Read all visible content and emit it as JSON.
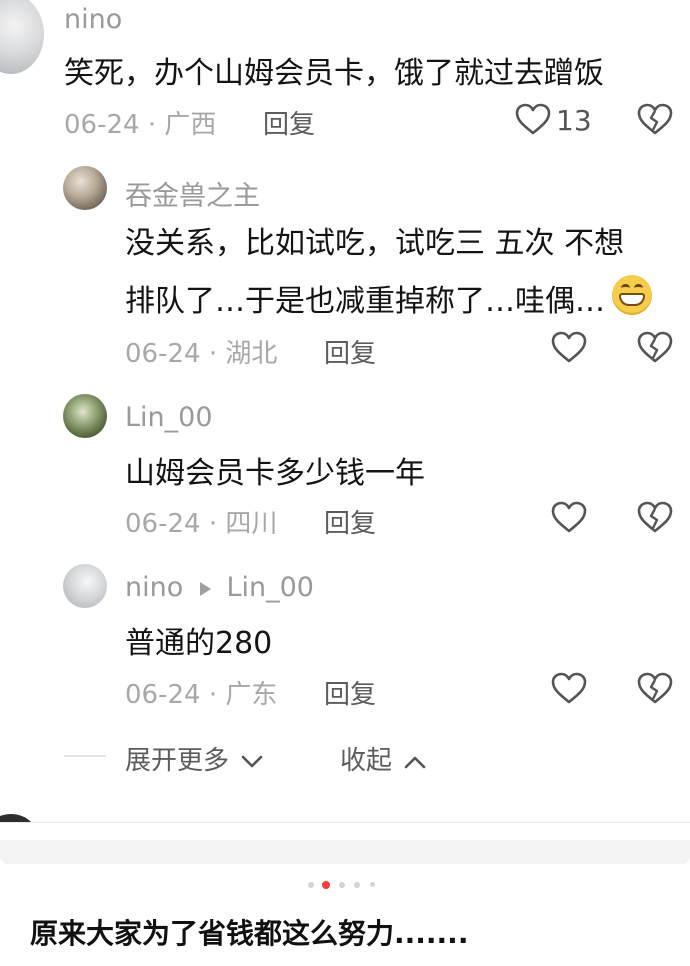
{
  "comments": [
    {
      "user": "nino",
      "text": "笑死，办个山姆会员卡，饿了就过去蹭饭",
      "date": "06-24",
      "location": "广西",
      "reply_label": "回复",
      "likes": "13"
    },
    {
      "user": "吞金兽之主",
      "text_line1": "没关系，比如试吃，试吃三 五次   不想",
      "text_line2": "排队了…于是也减重掉称了…哇偶…",
      "date": "06-24",
      "location": "湖北",
      "reply_label": "回复"
    },
    {
      "user": "Lin_00",
      "text": "山姆会员卡多少钱一年",
      "date": "06-24",
      "location": "四川",
      "reply_label": "回复"
    },
    {
      "user": "nino",
      "reply_to": "Lin_00",
      "text": "普通的280",
      "date": "06-24",
      "location": "广东",
      "reply_label": "回复"
    }
  ],
  "thread_controls": {
    "expand_more": "展开更多",
    "collapse": "收起"
  },
  "caption": "原来大家为了省钱都这么努力.......",
  "icons": {
    "like": "heart-icon",
    "dislike": "broken-heart-icon",
    "reply_arrow": "triangle-right-icon",
    "expand": "chevron-down-icon",
    "collapse": "chevron-up-icon",
    "emoji": "grin-emoji"
  },
  "pager": {
    "total": 5,
    "active_index": 1
  },
  "colors": {
    "active_dot": "#ff3b3b",
    "meta_gray": "#a8a8a8",
    "text": "#141414"
  }
}
